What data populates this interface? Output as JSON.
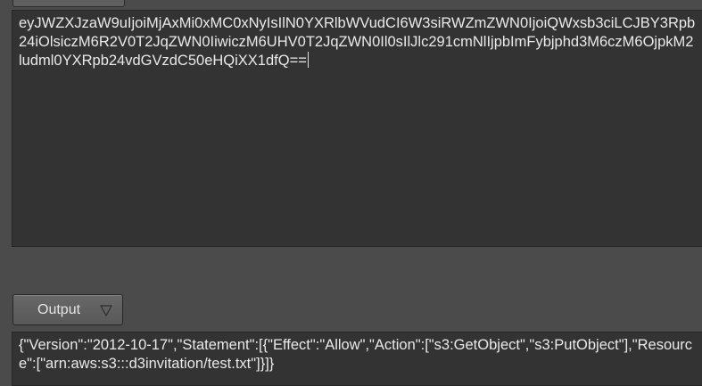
{
  "input": {
    "value": "eyJWZXJzaW9uIjoiMjAxMi0xMC0xNyIsIlN0YXRlbWVudCI6W3siRWZmZWN0IjoiQWxsb3ciLCJBY3Rpb24iOlsiczM6R2V0T2JqZWN0IiwiczM6UHV0T2JqZWN0Il0sIlJlc291cmNlIjpbImFybjphd3M6czM6OjpkM2ludml0YXRpb24vdGVzdC50eHQiXX1dfQ=="
  },
  "output_selector": {
    "label": "Output",
    "icon": "triangle-down-icon"
  },
  "output": {
    "value": "{\"Version\":\"2012-10-17\",\"Statement\":[{\"Effect\":\"Allow\",\"Action\":[\"s3:GetObject\",\"s3:PutObject\"],\"Resource\":[\"arn:aws:s3:::d3invitation/test.txt\"]}]}"
  },
  "colors": {
    "background": "#4b4b4b",
    "textbox": "#333333",
    "text": "#e9e9e9"
  }
}
